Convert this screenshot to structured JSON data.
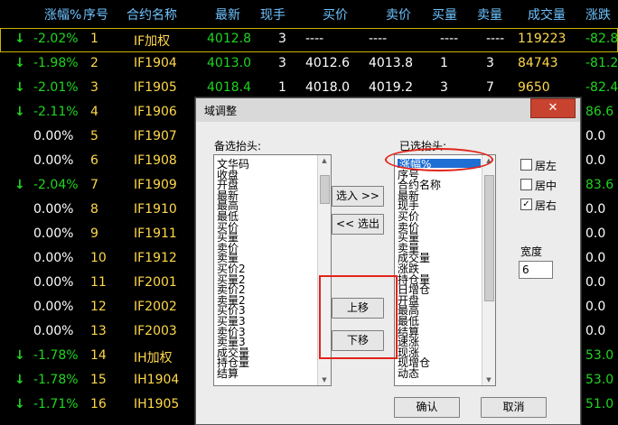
{
  "columns": [
    "涨幅%",
    "序号",
    "合约名称",
    "最新",
    "现手",
    "买价",
    "卖价",
    "买量",
    "卖量",
    "成交量",
    "涨跌"
  ],
  "rows": [
    {
      "arrow": "↓",
      "chg": "-2.02%",
      "no": "1",
      "name": "IF加权",
      "last": "4012.8",
      "vol_now": "3",
      "bid": "----",
      "ask": "----",
      "bid_qty": "----",
      "ask_qty": "----",
      "volume": "119223",
      "diff": "-82.8"
    },
    {
      "arrow": "↓",
      "chg": "-1.98%",
      "no": "2",
      "name": "IF1904",
      "last": "4013.0",
      "vol_now": "3",
      "bid": "4012.6",
      "ask": "4013.8",
      "bid_qty": "1",
      "ask_qty": "3",
      "volume": "84743",
      "diff": "-81.2"
    },
    {
      "arrow": "↓",
      "chg": "-2.01%",
      "no": "3",
      "name": "IF1905",
      "last": "4018.4",
      "vol_now": "1",
      "bid": "4018.0",
      "ask": "4019.2",
      "bid_qty": "3",
      "ask_qty": "7",
      "volume": "9650",
      "diff": "-82.4"
    },
    {
      "arrow": "↓",
      "chg": "-2.11%",
      "no": "4",
      "name": "IF1906",
      "last": "",
      "vol_now": "",
      "bid": "",
      "ask": "",
      "bid_qty": "",
      "ask_qty": "",
      "volume": "",
      "diff": "86.6"
    },
    {
      "arrow": "",
      "chg": "0.00%",
      "no": "5",
      "name": "IF1907",
      "last": "",
      "vol_now": "",
      "bid": "",
      "ask": "",
      "bid_qty": "",
      "ask_qty": "",
      "volume": "",
      "diff": "0.0"
    },
    {
      "arrow": "",
      "chg": "0.00%",
      "no": "6",
      "name": "IF1908",
      "last": "",
      "vol_now": "",
      "bid": "",
      "ask": "",
      "bid_qty": "",
      "ask_qty": "",
      "volume": "",
      "diff": "0.0"
    },
    {
      "arrow": "↓",
      "chg": "-2.04%",
      "no": "7",
      "name": "IF1909",
      "last": "",
      "vol_now": "",
      "bid": "",
      "ask": "",
      "bid_qty": "",
      "ask_qty": "",
      "volume": "",
      "diff": "83.6"
    },
    {
      "arrow": "",
      "chg": "0.00%",
      "no": "8",
      "name": "IF1910",
      "last": "",
      "vol_now": "",
      "bid": "",
      "ask": "",
      "bid_qty": "",
      "ask_qty": "",
      "volume": "",
      "diff": "0.0"
    },
    {
      "arrow": "",
      "chg": "0.00%",
      "no": "9",
      "name": "IF1911",
      "last": "",
      "vol_now": "",
      "bid": "",
      "ask": "",
      "bid_qty": "",
      "ask_qty": "",
      "volume": "",
      "diff": "0.0"
    },
    {
      "arrow": "",
      "chg": "0.00%",
      "no": "10",
      "name": "IF1912",
      "last": "",
      "vol_now": "",
      "bid": "",
      "ask": "",
      "bid_qty": "",
      "ask_qty": "",
      "volume": "",
      "diff": "0.0"
    },
    {
      "arrow": "",
      "chg": "0.00%",
      "no": "11",
      "name": "IF2001",
      "last": "",
      "vol_now": "",
      "bid": "",
      "ask": "",
      "bid_qty": "",
      "ask_qty": "",
      "volume": "",
      "diff": "0.0"
    },
    {
      "arrow": "",
      "chg": "0.00%",
      "no": "12",
      "name": "IF2002",
      "last": "",
      "vol_now": "",
      "bid": "",
      "ask": "",
      "bid_qty": "",
      "ask_qty": "",
      "volume": "",
      "diff": "0.0"
    },
    {
      "arrow": "",
      "chg": "0.00%",
      "no": "13",
      "name": "IF2003",
      "last": "",
      "vol_now": "",
      "bid": "",
      "ask": "",
      "bid_qty": "",
      "ask_qty": "",
      "volume": "",
      "diff": "0.0"
    },
    {
      "arrow": "↓",
      "chg": "-1.78%",
      "no": "14",
      "name": "IH加权",
      "last": "",
      "vol_now": "",
      "bid": "",
      "ask": "",
      "bid_qty": "",
      "ask_qty": "",
      "volume": "",
      "diff": "53.0"
    },
    {
      "arrow": "↓",
      "chg": "-1.78%",
      "no": "15",
      "name": "IH1904",
      "last": "",
      "vol_now": "",
      "bid": "",
      "ask": "",
      "bid_qty": "",
      "ask_qty": "",
      "volume": "",
      "diff": "53.0"
    },
    {
      "arrow": "↓",
      "chg": "-1.71%",
      "no": "16",
      "name": "IH1905",
      "last": "",
      "vol_now": "",
      "bid": "",
      "ask": "",
      "bid_qty": "",
      "ask_qty": "",
      "volume": "",
      "diff": "51.0"
    }
  ],
  "dialog": {
    "title": "域调整",
    "close_glyph": "✕",
    "available_label": "备选抬头:",
    "selected_label": "已选抬头:",
    "available_items": [
      "文华码",
      "收盘",
      "开盘",
      "最新",
      "最高",
      "最低",
      "买价",
      "买量",
      "卖价",
      "卖量",
      "买价2",
      "买量2",
      "卖价2",
      "卖量2",
      "买价3",
      "买量3",
      "卖价3",
      "卖量3",
      "成交量",
      "持仓量",
      "结算"
    ],
    "selected_items": [
      "涨幅%",
      "序号",
      "合约名称",
      "最新",
      "现手",
      "买价",
      "卖价",
      "买量",
      "卖量",
      "成交量",
      "涨跌",
      "持仓量",
      "日增仓",
      "开盘",
      "最高",
      "最低",
      "结算",
      "速涨",
      "现涨",
      "现增仓",
      "动态"
    ],
    "select_in": "选入 >>",
    "select_out": "<< 选出",
    "move_up": "上移",
    "move_down": "下移",
    "align_left": "居左",
    "align_center": "居中",
    "align_right": "居右",
    "width_label": "宽度",
    "width_value": "6",
    "ok": "确认",
    "cancel": "取消",
    "check_glyph": "✓"
  }
}
